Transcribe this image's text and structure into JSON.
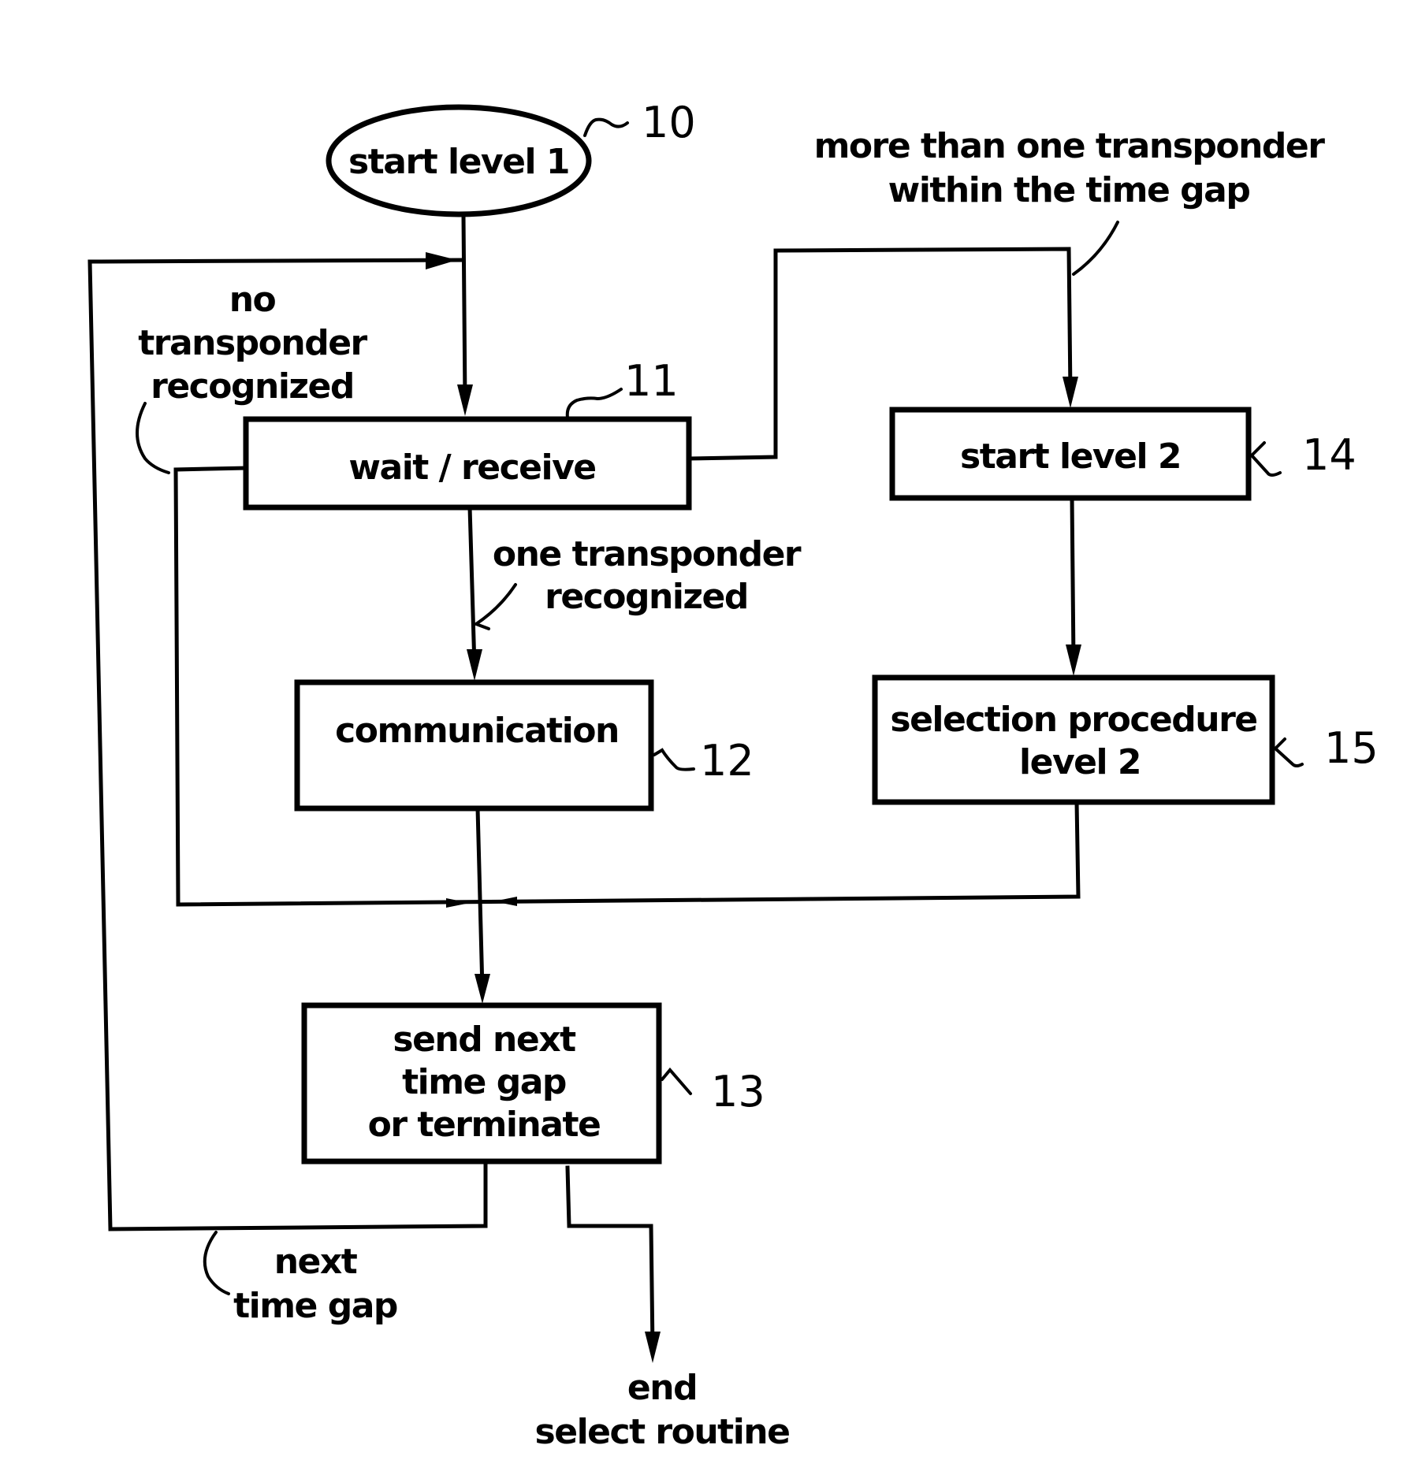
{
  "diagram": {
    "type": "flowchart",
    "nodes": {
      "start_level_1": {
        "label": "start level 1",
        "ref": "10",
        "shape": "ellipse"
      },
      "wait_receive": {
        "label": "wait / receive",
        "ref": "11"
      },
      "communication": {
        "label": "communication",
        "ref": "12"
      },
      "send_next": {
        "lines": [
          "send next",
          "time gap",
          "or terminate"
        ],
        "ref": "13"
      },
      "start_level_2": {
        "label": "start level 2",
        "ref": "14"
      },
      "selection_procedure": {
        "lines": [
          "selection procedure",
          "level 2"
        ],
        "ref": "15"
      }
    },
    "edge_labels": {
      "no_transponder": [
        "no",
        "transponder",
        "recognized"
      ],
      "one_transponder": [
        "one transponder",
        "recognized"
      ],
      "more_than_one": [
        "more than one transponder",
        "within the time gap"
      ],
      "next_time_gap": [
        "next",
        "time gap"
      ],
      "end_select": [
        "end",
        "select routine"
      ]
    },
    "edges": [
      {
        "from": "start_level_1",
        "to": "wait_receive"
      },
      {
        "from": "wait_receive",
        "to": "communication",
        "label": "one transponder recognized"
      },
      {
        "from": "wait_receive",
        "to": "start_level_2",
        "label": "more than one transponder within the time gap"
      },
      {
        "from": "wait_receive",
        "to": "send_next",
        "label": "no transponder recognized"
      },
      {
        "from": "communication",
        "to": "send_next"
      },
      {
        "from": "start_level_2",
        "to": "selection_procedure"
      },
      {
        "from": "selection_procedure",
        "to": "send_next"
      },
      {
        "from": "send_next",
        "to": "wait_receive",
        "label": "next time gap"
      },
      {
        "from": "send_next",
        "to": "end",
        "label": "end select routine"
      }
    ]
  }
}
